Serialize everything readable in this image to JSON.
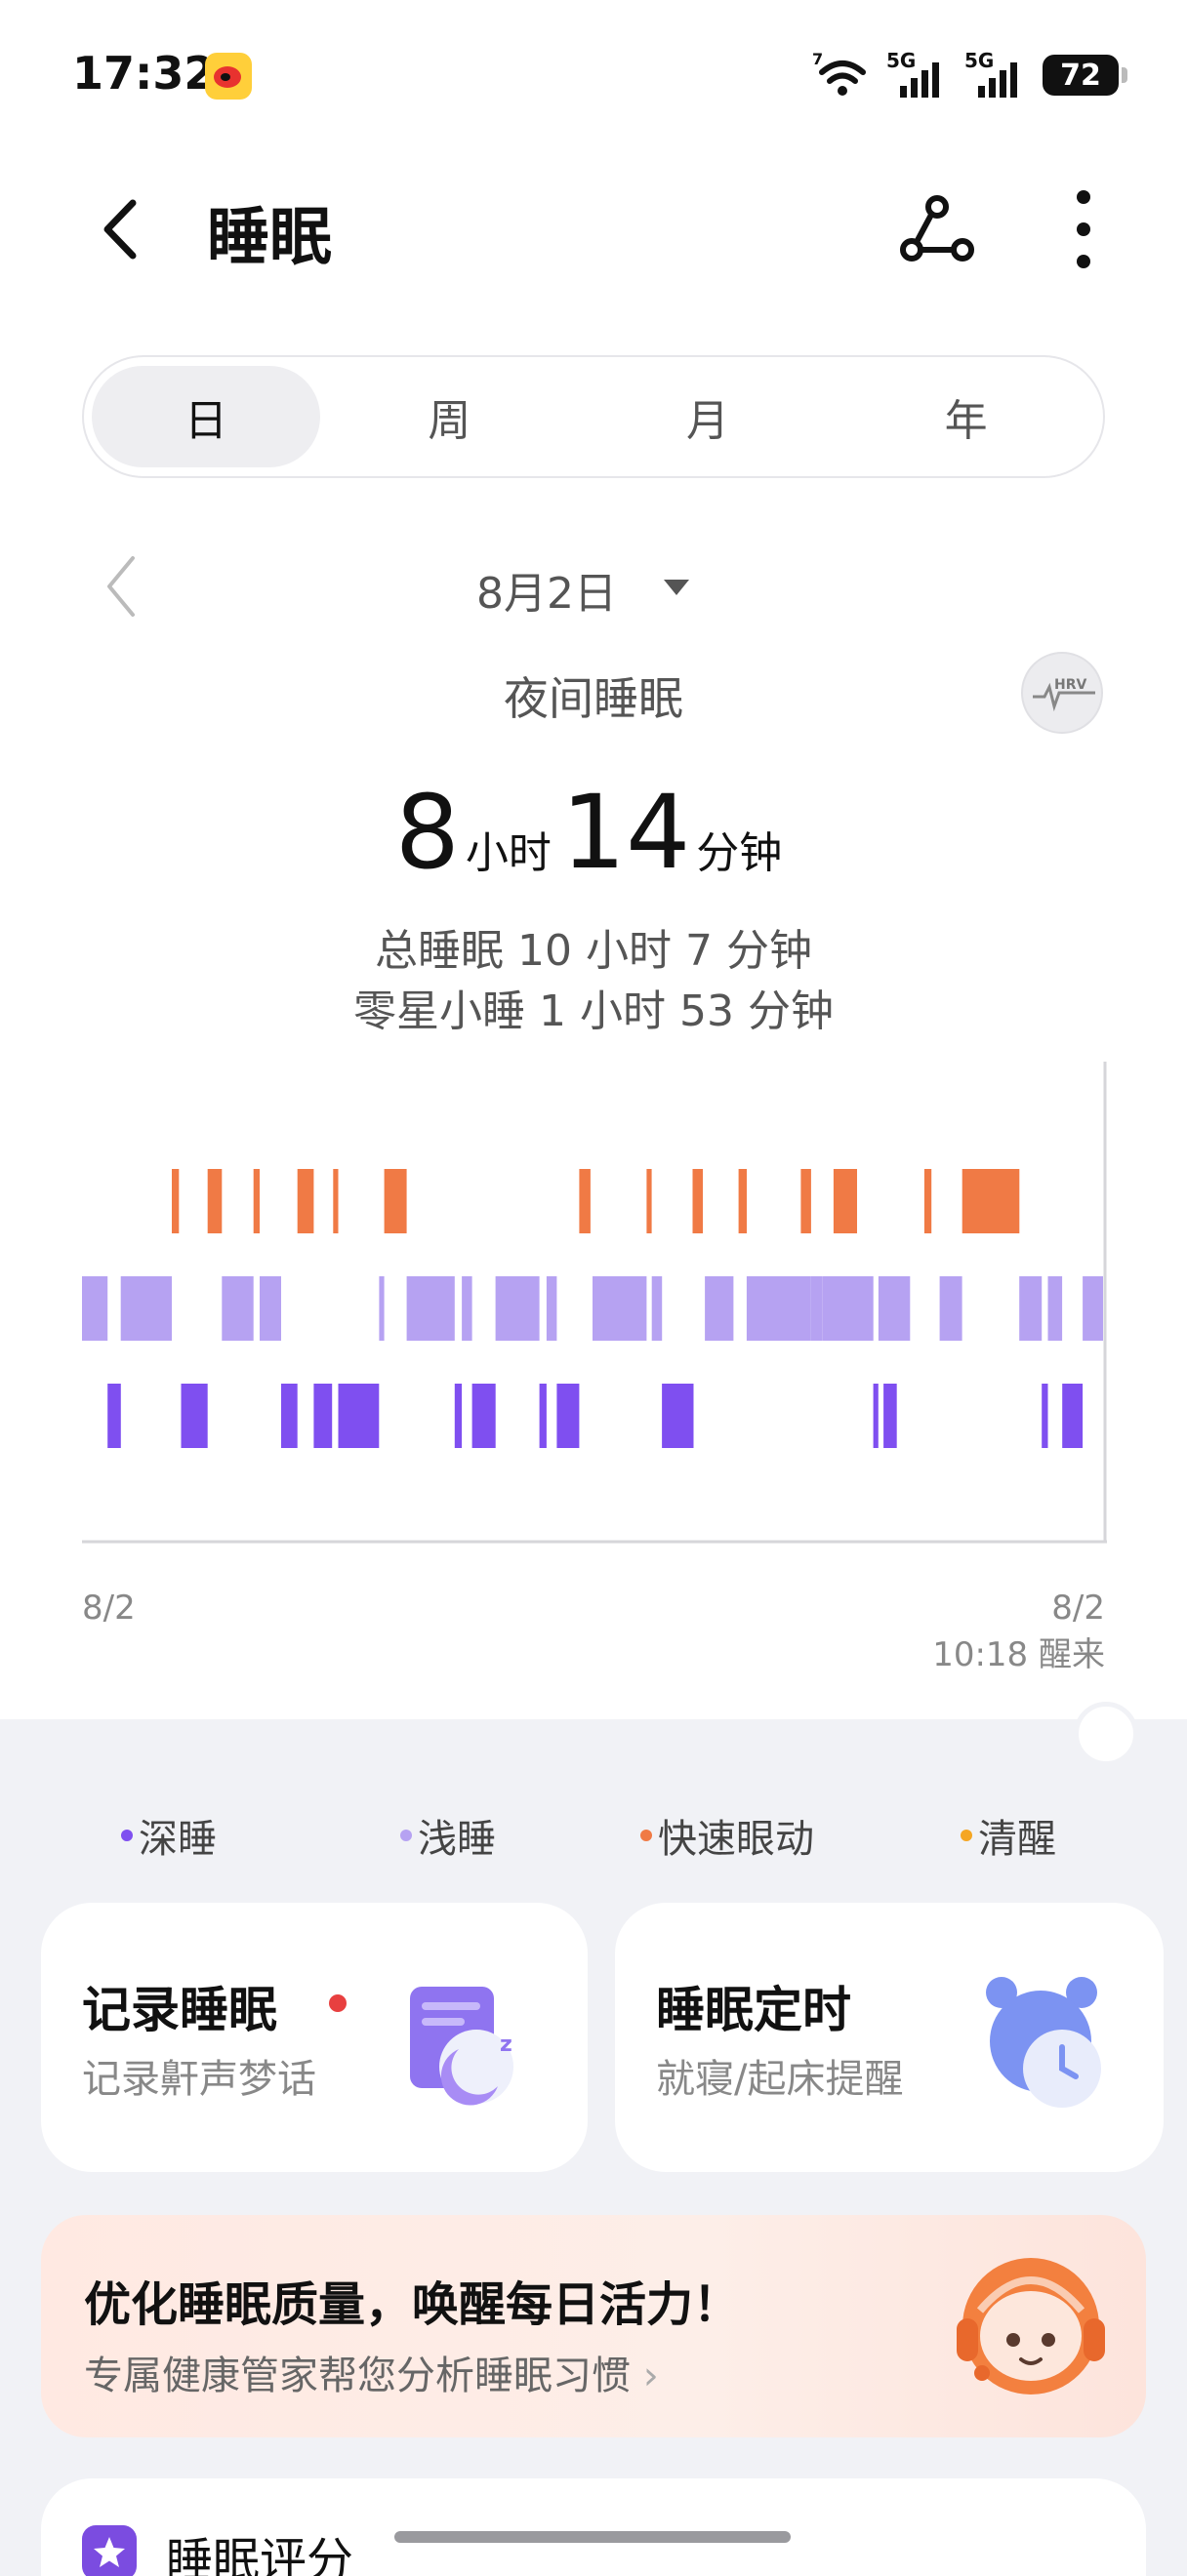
{
  "status_bar": {
    "time": "17:32",
    "signal1_label": "5G",
    "signal2_label": "5G",
    "wifi_label": "7",
    "battery": "72"
  },
  "header": {
    "title": "睡眠"
  },
  "tabs": [
    {
      "label": "日",
      "active": true
    },
    {
      "label": "周",
      "active": false
    },
    {
      "label": "月",
      "active": false
    },
    {
      "label": "年",
      "active": false
    }
  ],
  "date_nav": {
    "date": "8月2日"
  },
  "summary": {
    "section": "夜间睡眠",
    "hrv_badge": "HRV",
    "hours": "8",
    "hours_unit": "小时",
    "minutes": "14",
    "minutes_unit": "分钟",
    "total_sleep": "总睡眠 10 小时 7 分钟",
    "nap": "零星小睡 1 小时 53 分钟"
  },
  "chart_data": {
    "type": "hypnogram",
    "stages": [
      "快速眼动",
      "浅睡",
      "深睡"
    ],
    "colors": {
      "快速眼动": "#f07a45",
      "浅睡": "#b6a2f2",
      "深睡": "#7f4ff0"
    },
    "x_start_label": "8/2",
    "x_end_label": "8/2",
    "wake_time": "10:18 醒来",
    "segments": [
      {
        "stage": "浅睡",
        "start": 0.0,
        "end": 0.025
      },
      {
        "stage": "深睡",
        "start": 0.025,
        "end": 0.038
      },
      {
        "stage": "浅睡",
        "start": 0.038,
        "end": 0.088
      },
      {
        "stage": "快速眼动",
        "start": 0.088,
        "end": 0.095
      },
      {
        "stage": "深睡",
        "start": 0.097,
        "end": 0.123
      },
      {
        "stage": "快速眼动",
        "start": 0.123,
        "end": 0.137
      },
      {
        "stage": "浅睡",
        "start": 0.137,
        "end": 0.168
      },
      {
        "stage": "快速眼动",
        "start": 0.168,
        "end": 0.174
      },
      {
        "stage": "浅睡",
        "start": 0.174,
        "end": 0.195
      },
      {
        "stage": "深睡",
        "start": 0.195,
        "end": 0.211
      },
      {
        "stage": "快速眼动",
        "start": 0.211,
        "end": 0.227
      },
      {
        "stage": "深睡",
        "start": 0.227,
        "end": 0.245
      },
      {
        "stage": "快速眼动",
        "start": 0.246,
        "end": 0.251
      },
      {
        "stage": "深睡",
        "start": 0.251,
        "end": 0.291
      },
      {
        "stage": "浅睡",
        "start": 0.291,
        "end": 0.296
      },
      {
        "stage": "快速眼动",
        "start": 0.296,
        "end": 0.318
      },
      {
        "stage": "浅睡",
        "start": 0.318,
        "end": 0.365
      },
      {
        "stage": "深睡",
        "start": 0.365,
        "end": 0.372
      },
      {
        "stage": "浅睡",
        "start": 0.372,
        "end": 0.382
      },
      {
        "stage": "深睡",
        "start": 0.382,
        "end": 0.405
      },
      {
        "stage": "浅睡",
        "start": 0.405,
        "end": 0.448
      },
      {
        "stage": "深睡",
        "start": 0.448,
        "end": 0.455
      },
      {
        "stage": "浅睡",
        "start": 0.455,
        "end": 0.465
      },
      {
        "stage": "深睡",
        "start": 0.465,
        "end": 0.487
      },
      {
        "stage": "快速眼动",
        "start": 0.487,
        "end": 0.498
      },
      {
        "stage": "浅睡",
        "start": 0.5,
        "end": 0.553
      },
      {
        "stage": "快速眼动",
        "start": 0.553,
        "end": 0.558
      },
      {
        "stage": "浅睡",
        "start": 0.558,
        "end": 0.568
      },
      {
        "stage": "深睡",
        "start": 0.568,
        "end": 0.599
      },
      {
        "stage": "浅睡",
        "start": 0.61,
        "end": 0.638
      },
      {
        "stage": "快速眼动",
        "start": 0.598,
        "end": 0.608
      },
      {
        "stage": "快速眼动",
        "start": 0.643,
        "end": 0.651
      },
      {
        "stage": "浅睡",
        "start": 0.651,
        "end": 0.714
      },
      {
        "stage": "快速眼动",
        "start": 0.704,
        "end": 0.714
      },
      {
        "stage": "浅睡",
        "start": 0.714,
        "end": 0.725
      },
      {
        "stage": "快速眼动",
        "start": 0.736,
        "end": 0.749
      },
      {
        "stage": "浅睡",
        "start": 0.725,
        "end": 0.775
      },
      {
        "stage": "快速眼动",
        "start": 0.749,
        "end": 0.759
      },
      {
        "stage": "深睡",
        "start": 0.775,
        "end": 0.78
      },
      {
        "stage": "浅睡",
        "start": 0.78,
        "end": 0.811
      },
      {
        "stage": "深睡",
        "start": 0.785,
        "end": 0.798
      },
      {
        "stage": "快速眼动",
        "start": 0.825,
        "end": 0.832
      },
      {
        "stage": "浅睡",
        "start": 0.84,
        "end": 0.862
      },
      {
        "stage": "快速眼动",
        "start": 0.862,
        "end": 0.918
      },
      {
        "stage": "浅睡",
        "start": 0.918,
        "end": 0.94
      },
      {
        "stage": "深睡",
        "start": 0.94,
        "end": 0.946
      },
      {
        "stage": "浅睡",
        "start": 0.946,
        "end": 0.96
      },
      {
        "stage": "深睡",
        "start": 0.96,
        "end": 0.98
      },
      {
        "stage": "浅睡",
        "start": 0.98,
        "end": 1.0
      }
    ]
  },
  "legend": [
    {
      "label": "深睡",
      "color": "#7f4ff0"
    },
    {
      "label": "浅睡",
      "color": "#b6a2f2"
    },
    {
      "label": "快速眼动",
      "color": "#f07a45"
    },
    {
      "label": "清醒",
      "color": "#f5a623"
    }
  ],
  "cards": {
    "record": {
      "title": "记录睡眠",
      "sub": "记录鼾声梦话"
    },
    "timer": {
      "title": "睡眠定时",
      "sub": "就寝/起床提醒"
    }
  },
  "promo": {
    "title": "优化睡眠质量，唤醒每日活力！",
    "sub": "专属健康管家帮您分析睡眠习惯"
  },
  "score": {
    "title": "睡眠评分"
  }
}
